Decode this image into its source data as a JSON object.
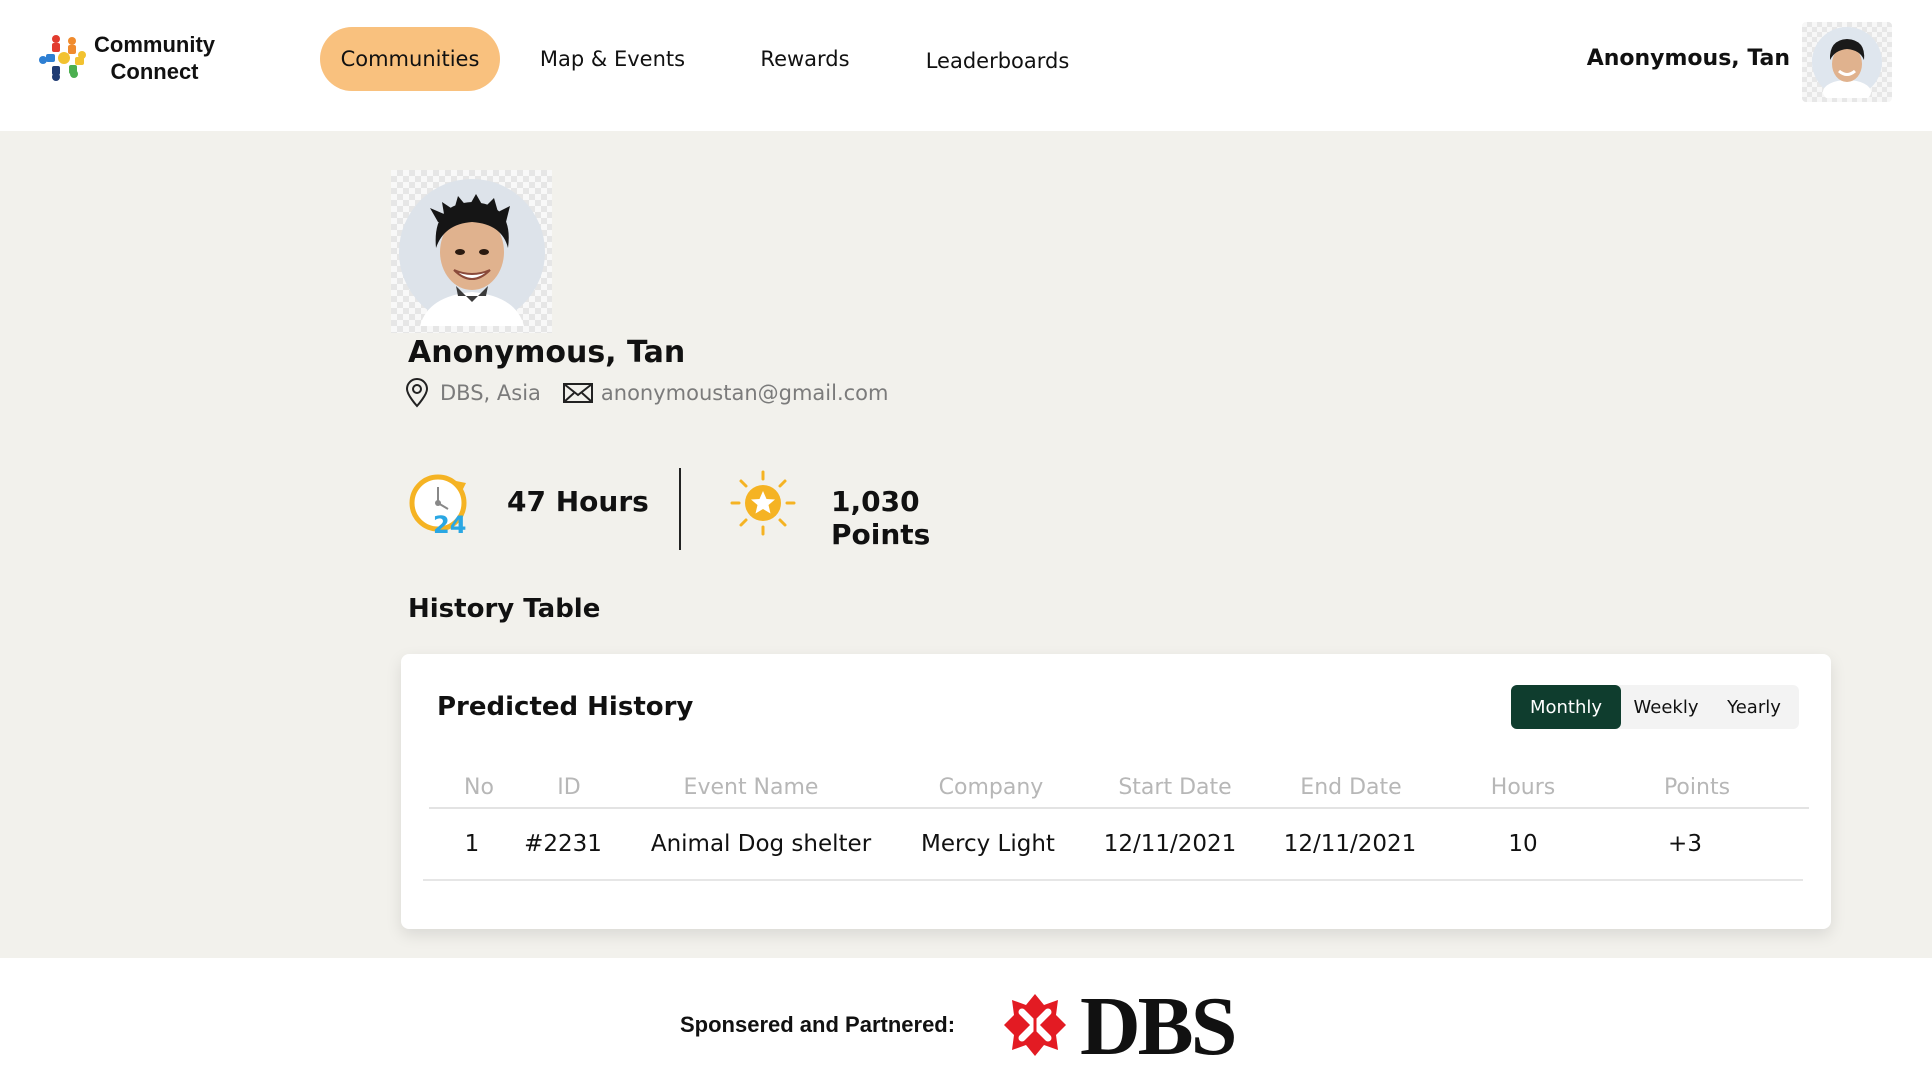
{
  "app": {
    "logo_line1": "Community",
    "logo_line2": "Connect"
  },
  "nav": {
    "items": [
      {
        "label": "Communities",
        "active": true
      },
      {
        "label": "Map & Events",
        "active": false
      },
      {
        "label": "Rewards",
        "active": false
      },
      {
        "label": "Leaderboards",
        "active": false
      }
    ]
  },
  "user": {
    "name": "Anonymous, Tan"
  },
  "profile": {
    "name": "Anonymous, Tan",
    "location": "DBS, Asia",
    "email": "anonymoustan@gmail.com",
    "hours": "47 Hours",
    "points": "1,030 Points"
  },
  "history": {
    "section_title": "History Table",
    "card_title": "Predicted History",
    "tabs": [
      {
        "label": "Monthly",
        "active": true
      },
      {
        "label": "Weekly",
        "active": false
      },
      {
        "label": "Yearly",
        "active": false
      }
    ],
    "columns": [
      "No",
      "ID",
      "Event Name",
      "Company",
      "Start Date",
      "End Date",
      "Hours",
      "Points"
    ],
    "rows": [
      [
        "1",
        "#2231",
        "Animal Dog shelter",
        "Mercy Light",
        "12/11/2021",
        "12/11/2021",
        "10",
        "+3"
      ]
    ]
  },
  "footer": {
    "sponsor_label": "Sponsered and Partnered:",
    "partner_logo": "DBS"
  },
  "colors": {
    "nav_active": "#f9c17e",
    "tab_active": "#0f3d2e",
    "page_bg": "#f2f1ec",
    "dbs_red": "#e31b23"
  },
  "icons": {
    "location": "location-pin-icon",
    "email": "envelope-icon",
    "hours": "clock-24-icon",
    "points": "star-sun-icon"
  }
}
